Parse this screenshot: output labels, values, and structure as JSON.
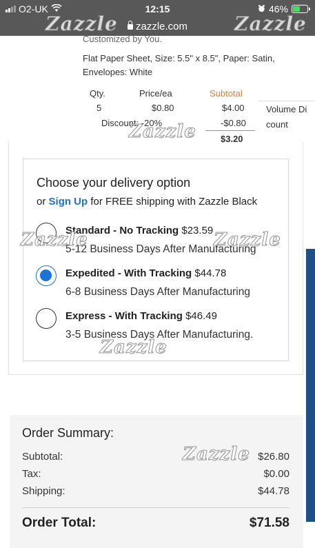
{
  "status_bar": {
    "carrier": "O2-UK",
    "time": "12:15",
    "battery": "46%",
    "battery_level": 0.46
  },
  "browser": {
    "url": "zazzle.com"
  },
  "product": {
    "customized_cut": "Customized by You.",
    "description": "Flat Paper Sheet, Size: 5.5\" x 8.5\", Paper: Satin, Envelopes: White"
  },
  "pricing": {
    "headers": {
      "qty": "Qty.",
      "price": "Price/ea",
      "subtotal": "Subtotal"
    },
    "qty": "5",
    "price_each": "$0.80",
    "subtotal": "$4.00",
    "discount_label": "Discount: -20%",
    "discount_value": "-$0.80",
    "total": "$3.20",
    "volume_discount_label": [
      "Volume Di",
      "count"
    ]
  },
  "delivery": {
    "title": "Choose your delivery option",
    "subtitle_prefix": "or",
    "signup_link": "Sign Up",
    "subtitle_suffix": "for FREE shipping with Zazzle Black",
    "options": [
      {
        "name": "Standard - No Tracking",
        "price": "$23.59",
        "days": "5-12 Business Days After Manufacturing",
        "selected": false
      },
      {
        "name": "Expedited - With Tracking",
        "price": "$44.78",
        "days": "6-8 Business Days After Manufacturing",
        "selected": true
      },
      {
        "name": "Express - With Tracking",
        "price": "$46.49",
        "days": "3-5 Business Days After Manufacturing.",
        "selected": false
      }
    ]
  },
  "order_summary": {
    "title": "Order Summary:",
    "rows": [
      {
        "label": "Subtotal:",
        "value": "$26.80"
      },
      {
        "label": "Tax:",
        "value": "$0.00"
      },
      {
        "label": "Shipping:",
        "value": "$44.78"
      }
    ],
    "total_label": "Order Total:",
    "total_value": "$71.58"
  },
  "watermark": "Zazzle",
  "colors": {
    "link": "#1a73d9",
    "subtotal_header": "#f07c2c",
    "chrome": "#585858",
    "battery": "#4cd964"
  }
}
